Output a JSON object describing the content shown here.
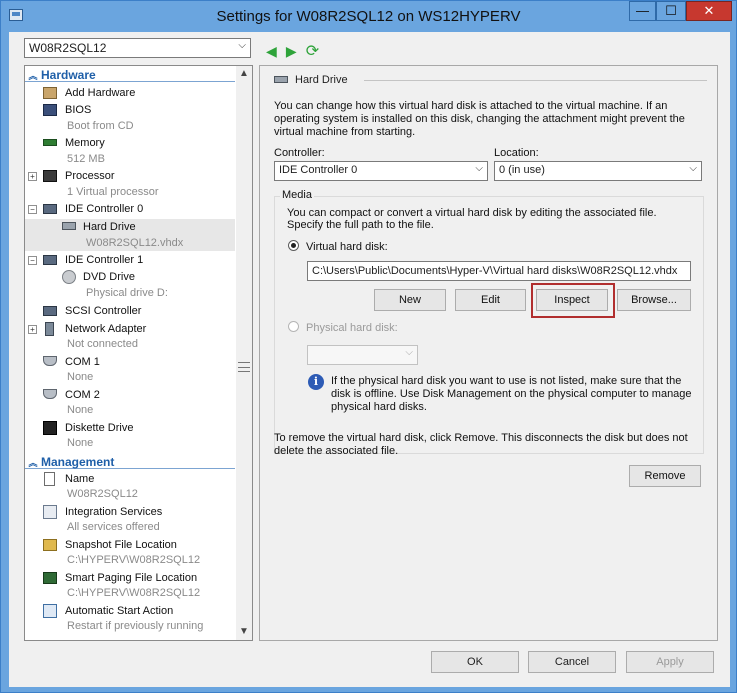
{
  "window": {
    "title": "Settings for W08R2SQL12 on WS12HYPERV",
    "min_glyph": "—",
    "max_glyph": "☐",
    "close_glyph": "✕"
  },
  "vm_selector": {
    "value": "W08R2SQL12"
  },
  "nav": {
    "back_glyph": "◀",
    "forward_glyph": "▶",
    "refresh_glyph": "⟳"
  },
  "hardware_section": {
    "label": "Hardware"
  },
  "management_section": {
    "label": "Management"
  },
  "hardware_items": [
    {
      "label": "Add Hardware",
      "sub": ""
    },
    {
      "label": "BIOS",
      "sub": "Boot from CD"
    },
    {
      "label": "Memory",
      "sub": "512 MB"
    },
    {
      "label": "Processor",
      "sub": "1 Virtual processor"
    },
    {
      "label": "IDE Controller 0",
      "sub": ""
    },
    {
      "label": "Hard Drive",
      "sub": "W08R2SQL12.vhdx"
    },
    {
      "label": "IDE Controller 1",
      "sub": ""
    },
    {
      "label": "DVD Drive",
      "sub": "Physical drive D:"
    },
    {
      "label": "SCSI Controller",
      "sub": ""
    },
    {
      "label": "Network Adapter",
      "sub": "Not connected"
    },
    {
      "label": "COM 1",
      "sub": "None"
    },
    {
      "label": "COM 2",
      "sub": "None"
    },
    {
      "label": "Diskette Drive",
      "sub": "None"
    }
  ],
  "management_items": [
    {
      "label": "Name",
      "sub": "W08R2SQL12"
    },
    {
      "label": "Integration Services",
      "sub": "All services offered"
    },
    {
      "label": "Snapshot File Location",
      "sub": "C:\\HYPERV\\W08R2SQL12"
    },
    {
      "label": "Smart Paging File Location",
      "sub": "C:\\HYPERV\\W08R2SQL12"
    },
    {
      "label": "Automatic Start Action",
      "sub": "Restart if previously running"
    }
  ],
  "hard_drive": {
    "group_title": "Hard Drive",
    "intro": [
      "You can change how this virtual hard disk is attached to the virtual machine. If an",
      "operating system is installed on this disk, changing the attachment might prevent the",
      "virtual machine from starting."
    ],
    "controller_label": "Controller:",
    "controller_value": "IDE Controller 0",
    "location_label": "Location:",
    "location_value": "0 (in use)",
    "media_label": "Media",
    "media_text": [
      "You can compact or convert a virtual hard disk by editing the associated file.",
      "Specify the full path to the file."
    ],
    "vhd_radio_label": "Virtual hard disk:",
    "vhd_path": "C:\\Users\\Public\\Documents\\Hyper-V\\Virtual hard disks\\W08R2SQL12.vhdx",
    "new_label": "New",
    "edit_label": "Edit",
    "inspect_label": "Inspect",
    "browse_label": "Browse...",
    "physical_radio_label": "Physical hard disk:",
    "info_text": [
      "If the physical hard disk you want to use is not listed, make sure that the",
      "disk is offline. Use Disk Management on the physical computer to manage",
      "physical hard disks."
    ],
    "remove_text": [
      "To remove the virtual hard disk, click Remove. This disconnects the disk but does not",
      "delete the associated file."
    ],
    "remove_label": "Remove"
  },
  "footer": {
    "ok_label": "OK",
    "cancel_label": "Cancel",
    "apply_label": "Apply"
  },
  "colors": {
    "accent": "#1f5fa8",
    "highlight": "#b12e2e",
    "title_bar": "#6aa5df"
  }
}
